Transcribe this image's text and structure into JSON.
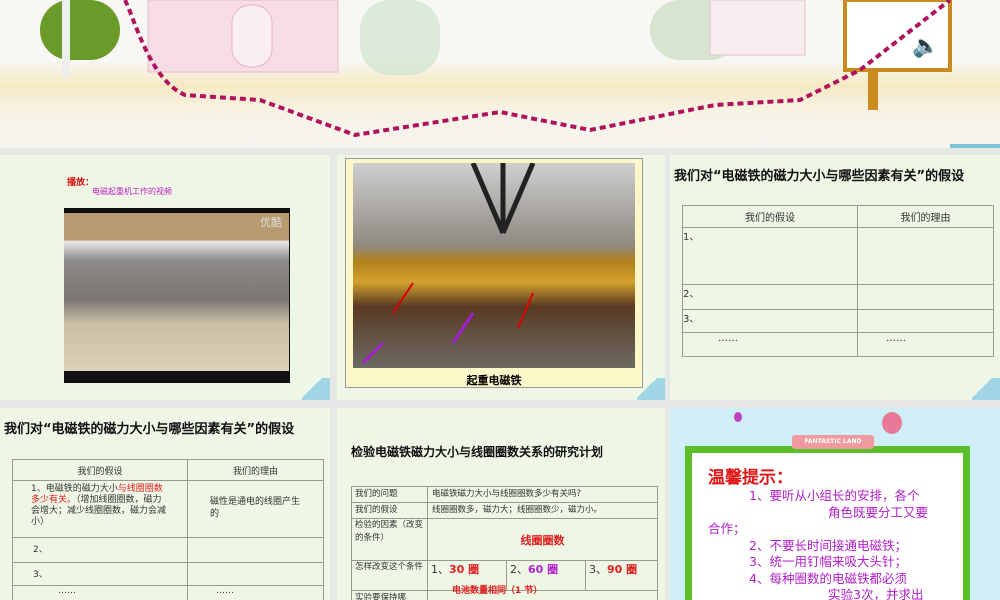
{
  "top_slide": {
    "icon": "speaker-icon"
  },
  "slide1": {
    "play_label": "播放：",
    "video_caption": "电磁起重机工作的视频",
    "watermark": "优酷"
  },
  "slide2": {
    "caption": "起重电磁铁"
  },
  "slide3": {
    "title": "我们对“电磁铁的磁力大小与哪些因素有关”的假设",
    "headers": [
      "我们的假设",
      "我们的理由"
    ],
    "rows": [
      [
        "1、",
        ""
      ],
      [
        "2、",
        ""
      ],
      [
        "3、",
        ""
      ],
      [
        "……",
        "……"
      ]
    ]
  },
  "slide4": {
    "title": "我们对“电磁铁的磁力大小与哪些因素有关”的假设",
    "headers": [
      "我们的假设",
      "我们的理由"
    ],
    "row1_prefix": "1、电磁铁的磁力大小",
    "row1_red": "与线圈圈数多少有关。",
    "row1_rest": "（增加线圈圈数，磁力会增大；减少线圈圈数，磁力会减小）",
    "row1_reason": "磁性是通电的线圈产生的",
    "rows": [
      "2、",
      "3、",
      "……",
      "……"
    ]
  },
  "slide5": {
    "title": "检验电磁铁磁力大小与线圈圈数关系的研究计划",
    "rows": [
      {
        "label": "我们的问题",
        "value": "电磁铁磁力大小与线圈圈数多少有关吗?"
      },
      {
        "label": "我们的假设",
        "value": "线圈圈数多，磁力大；线圈圈数少，磁力小。"
      },
      {
        "label": "检验的因素（改变的条件）",
        "value": "线圈圈数"
      }
    ],
    "change_label": "怎样改变这个条件",
    "options": [
      {
        "n": "1、",
        "v": "30 圈"
      },
      {
        "n": "2、",
        "v": "60 圈"
      },
      {
        "n": "3、",
        "v": "90 圈"
      }
    ],
    "same_note": "电池数量相同（1 节）",
    "keep_label": "实验要保持哪"
  },
  "slide6": {
    "banner": "FANTASTIC LAND",
    "title": "温馨提示：",
    "lines": [
      "1、要听从小组长的安排，各个",
      "角色既要分工又要",
      "合作；",
      "2、不要长时间接通电磁铁；",
      "3、统一用钉帽来吸大头针；",
      "4、每种圈数的电磁铁都必须",
      "实验3次，并求出"
    ]
  }
}
